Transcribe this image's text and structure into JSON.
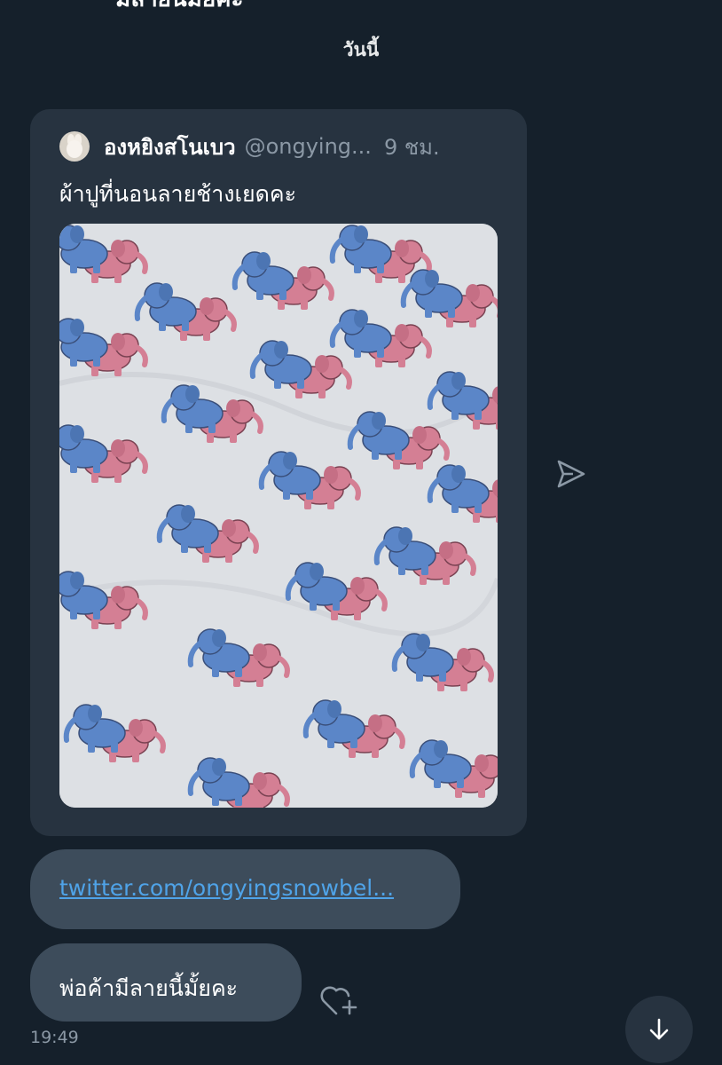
{
  "conversation": {
    "cut_off_header": "มีลายนี้มั้ยคะ",
    "date_label": "วันนี้"
  },
  "quoted_tweet": {
    "author_name": "องหยิงสโนเบว",
    "author_handle": "@ongying...",
    "time_ago": "9 ชม.",
    "text": "ผ้าปูที่นอนลายช้างเยดคะ",
    "media": {
      "description": "elephant-pattern-bedsheet-photo",
      "colors": {
        "fabric": "#dde0e4",
        "blue_elephant": "#5b86c8",
        "pink_elephant": "#d47f94"
      }
    }
  },
  "messages": [
    {
      "type": "link",
      "text": "twitter.com/ongyingsnowbel..."
    },
    {
      "type": "text",
      "text": "พ่อค้ามีลายนี้มั้ยคะ"
    }
  ],
  "last_message_time": "19:49",
  "icons": {
    "share": "paper-plane-icon",
    "react": "heart-plus-icon",
    "scroll": "arrow-down-icon"
  },
  "colors": {
    "background": "#15202b",
    "bubble": "#3d4c5b",
    "card": "#273340",
    "link": "#4fa3e8",
    "muted": "#8b98a5"
  }
}
